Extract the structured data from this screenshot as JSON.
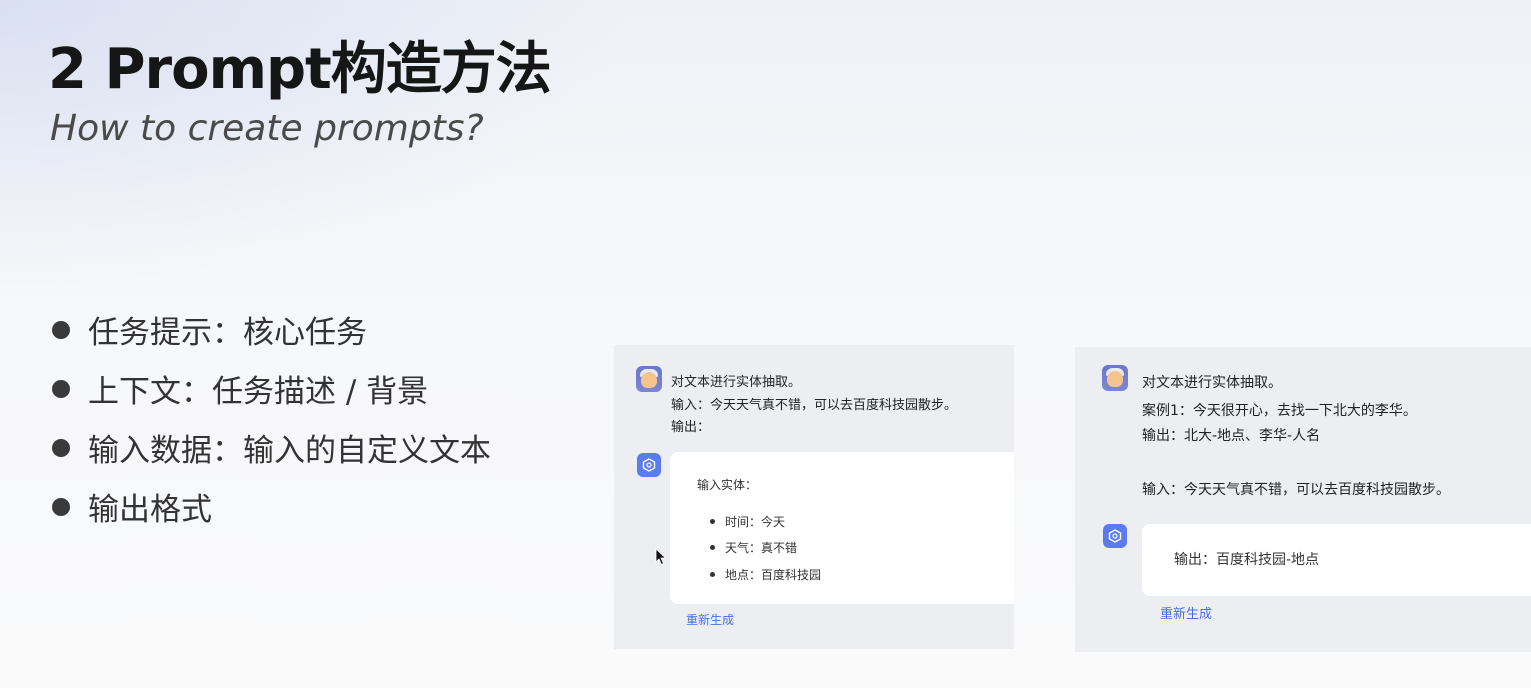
{
  "slide": {
    "title": "2 Prompt构造方法",
    "subtitle": "How to create prompts?",
    "bullets": [
      "任务提示：核心任务",
      "上下文：任务描述 / 背景",
      "输入数据：输入的自定义文本",
      "输出格式"
    ]
  },
  "examples": {
    "left": {
      "user_lines": [
        "对文本进行实体抽取。",
        "输入：今天天气真不错，可以去百度科技园散步。",
        "输出："
      ],
      "reply_heading": "输入实体：",
      "reply_items": [
        "时间：今天",
        "天气：真不错",
        "地点：百度科技园"
      ],
      "regenerate_label": "重新生成"
    },
    "right": {
      "user_lines": [
        "对文本进行实体抽取。",
        "案例1：今天很开心，去找一下北大的李华。",
        "输出：北大-地点、李华-人名",
        "输入：今天天气真不错，可以去百度科技园散步。"
      ],
      "reply_text": "输出：百度科技园-地点",
      "regenerate_label": "重新生成"
    }
  },
  "icons": {
    "user_avatar": "user-avatar",
    "bot": "bot-icon",
    "cursor": "mouse-cursor-icon"
  },
  "colors": {
    "accent": "#5b7cf0",
    "link": "#4a6de0",
    "panel_bg": "#eceef2"
  }
}
